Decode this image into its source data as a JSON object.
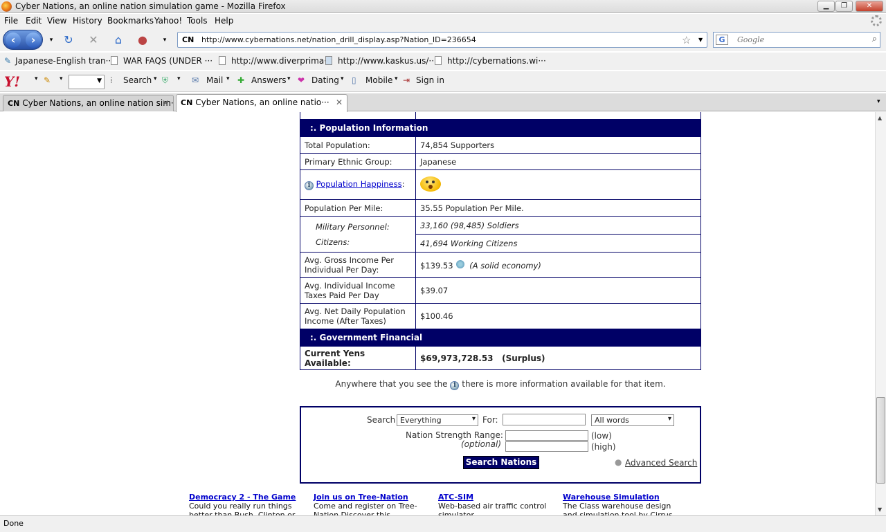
{
  "window": {
    "title": "Cyber Nations, an online nation simulation game - Mozilla Firefox"
  },
  "menu": [
    "File",
    "Edit",
    "View",
    "History",
    "Bookmarks",
    "Yahoo!",
    "Tools",
    "Help"
  ],
  "nav": {
    "url": "http://www.cybernations.net/nation_drill_display.asp?Nation_ID=236654",
    "site_badge": "CN",
    "search_placeholder": "Google"
  },
  "bookmarks": [
    "Japanese-English tran···",
    "WAR FAQS (UNDER ···",
    "http://www.diverprima···",
    "http://www.kaskus.us/···",
    "http://cybernations.wi···"
  ],
  "yahoo_toolbar": [
    "Search",
    "Mail",
    "Answers",
    "Dating",
    "Mobile",
    "Sign in"
  ],
  "tabs": [
    {
      "badge": "CN",
      "label": "Cyber Nations, an online nation sim···"
    },
    {
      "badge": "CN",
      "label": "Cyber Nations, an online natio···"
    }
  ],
  "population": {
    "section_title": ":. Population Information",
    "total_label": "Total Population:",
    "total_value": "74,854 Supporters",
    "ethnic_label": "Primary Ethnic Group:",
    "ethnic_value": "Japanese",
    "happiness_label": "Population Happiness",
    "per_mile_label": "Population Per Mile:",
    "per_mile_value": "35.55 Population Per Mile.",
    "military_label": "Military Personnel:",
    "military_value": "33,160 (98,485) Soldiers",
    "citizens_label": "Citizens:",
    "citizens_value": "41,694 Working Citizens",
    "gross_label": "Avg. Gross Income Per Individual Per Day:",
    "gross_value": "$139.53",
    "gross_note": "(A solid economy)",
    "tax_label": "Avg. Individual Income Taxes Paid Per Day",
    "tax_value": "$39.07",
    "net_label": "Avg. Net Daily Population Income (After Taxes)",
    "net_value": "$100.46"
  },
  "government": {
    "section_title": ":. Government Financial",
    "yens_label": "Current Yens Available:",
    "yens_value": "$69,973,728.53",
    "yens_status": "(Surplus)"
  },
  "note": {
    "before": "Anywhere that you see the",
    "after": "there is more information available for that item."
  },
  "search_panel": {
    "search_label": "Search",
    "scope": "Everything",
    "for_label": "For:",
    "words": "All words",
    "range_label": "Nation Strength Range:",
    "optional": "(optional)",
    "low": "(low)",
    "high": "(high)",
    "button": "Search Nations",
    "advanced": "Advanced Search"
  },
  "ads": [
    {
      "title": "Democracy 2 - The Game",
      "text": "Could you really run things better than Bush, Clinton or"
    },
    {
      "title": "Join us on Tree-Nation",
      "text": "Come and register on Tree-Nation Discover this"
    },
    {
      "title": "ATC-SIM",
      "text": "Web-based air traffic control simulator."
    },
    {
      "title": "Warehouse Simulation",
      "text": "The Class warehouse design and simulation tool by Cirrus"
    }
  ],
  "status": "Done"
}
